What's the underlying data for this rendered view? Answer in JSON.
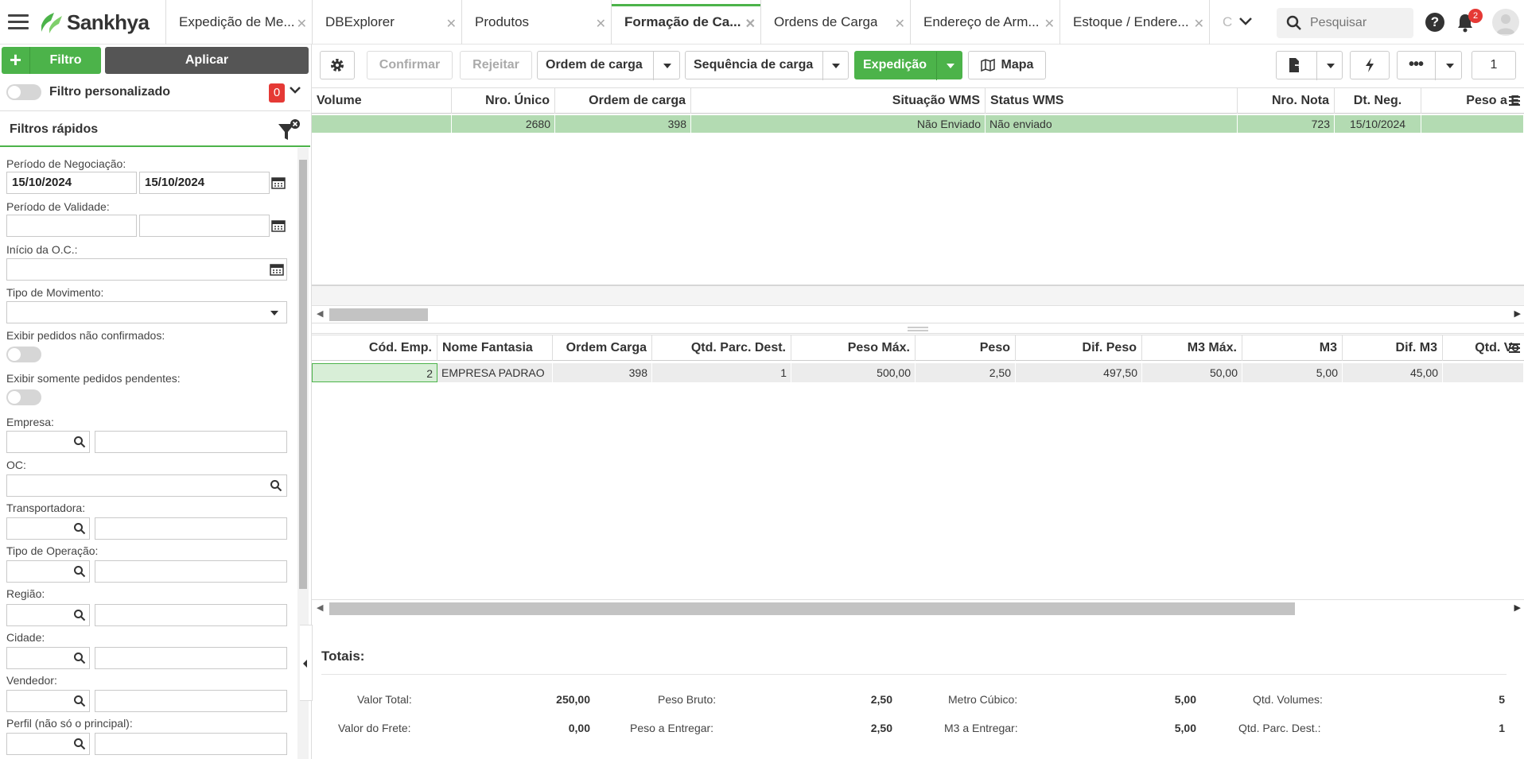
{
  "app": {
    "brand": "Sankhya"
  },
  "tabs": [
    {
      "label": "Expedição de Me...",
      "active": false
    },
    {
      "label": "DBExplorer",
      "active": false
    },
    {
      "label": "Produtos",
      "active": false
    },
    {
      "label": "Formação de Ca...",
      "active": true
    },
    {
      "label": "Ordens de Carga",
      "active": false
    },
    {
      "label": "Endereço de Arm...",
      "active": false
    },
    {
      "label": "Estoque / Endere...",
      "active": false
    },
    {
      "label": "C",
      "active": false
    }
  ],
  "search": {
    "placeholder": "Pesquisar"
  },
  "notifications": {
    "count": "2"
  },
  "left": {
    "filtro_label": "Filtro",
    "aplicar_label": "Aplicar",
    "filtro_personalizado": "Filtro personalizado",
    "filtro_count": "0",
    "filtros_rapidos": "Filtros rápidos",
    "fields": {
      "periodo_negociacao": "Período de Negociação:",
      "periodo_negociacao_de": "15/10/2024",
      "periodo_negociacao_ate": "15/10/2024",
      "periodo_validade": "Período de Validade:",
      "inicio_oc": "Início da O.C.:",
      "tipo_movimento": "Tipo de Movimento:",
      "exibir_nao_confirmados": "Exibir pedidos não confirmados:",
      "exibir_pendentes": "Exibir somente pedidos pendentes:",
      "empresa": "Empresa:",
      "oc": "OC:",
      "transportadora": "Transportadora:",
      "tipo_operacao": "Tipo de Operação:",
      "regiao": "Região:",
      "cidade": "Cidade:",
      "vendedor": "Vendedor:",
      "perfil": "Perfil (não só o principal):"
    }
  },
  "toolbar": {
    "confirmar": "Confirmar",
    "rejeitar": "Rejeitar",
    "ordem_carga": "Ordem de carga",
    "sequencia_carga": "Sequência de carga",
    "expedicao": "Expedição",
    "mapa": "Mapa",
    "page": "1"
  },
  "grid1": {
    "columns": [
      "Volume",
      "Nro. Único",
      "Ordem de carga",
      "Situação WMS",
      "Status WMS",
      "Nro. Nota",
      "Dt. Neg.",
      "Peso a E"
    ],
    "rows": [
      [
        "",
        "2680",
        "398",
        "Não Enviado",
        "Não enviado",
        "723",
        "15/10/2024",
        ""
      ]
    ]
  },
  "grid2": {
    "columns": [
      "Cód. Emp.",
      "Nome Fantasia",
      "Ordem Carga",
      "Qtd. Parc. Dest.",
      "Peso Máx.",
      "Peso",
      "Dif. Peso",
      "M3 Máx.",
      "M3",
      "Dif. M3",
      "Qtd. Vo"
    ],
    "rows": [
      [
        "2",
        "EMPRESA PADRAO",
        "398",
        "1",
        "500,00",
        "2,50",
        "497,50",
        "50,00",
        "5,00",
        "45,00",
        ""
      ]
    ]
  },
  "totais": {
    "title": "Totais:",
    "valor_total_label": "Valor Total:",
    "valor_total": "250,00",
    "valor_frete_label": "Valor do Frete:",
    "valor_frete": "0,00",
    "peso_bruto_label": "Peso Bruto:",
    "peso_bruto": "2,50",
    "peso_entregar_label": "Peso a Entregar:",
    "peso_entregar": "2,50",
    "metro_cubico_label": "Metro Cúbico:",
    "metro_cubico": "5,00",
    "m3_entregar_label": "M3 a Entregar:",
    "m3_entregar": "5,00",
    "qtd_volumes_label": "Qtd. Volumes:",
    "qtd_volumes": "5",
    "qtd_parc_label": "Qtd. Parc. Dest.:",
    "qtd_parc": "1"
  },
  "colors": {
    "accent": "#4cb34a",
    "badge": "#e53935",
    "row_selected": "#c9e6c8"
  }
}
